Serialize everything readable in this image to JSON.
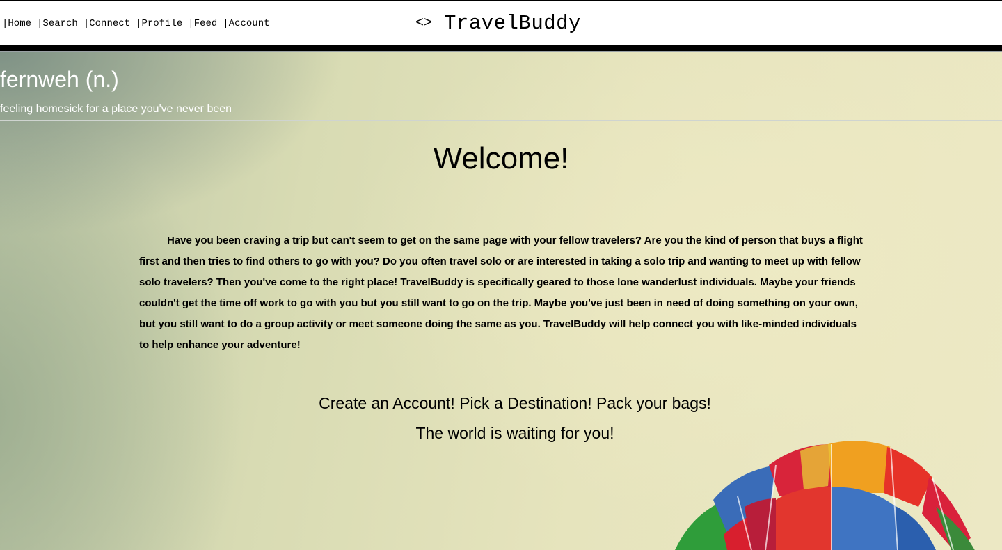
{
  "nav": {
    "items": [
      {
        "label": "Home"
      },
      {
        "label": "Search"
      },
      {
        "label": "Connect"
      },
      {
        "label": "Profile"
      },
      {
        "label": "Feed"
      },
      {
        "label": "Account"
      }
    ],
    "separator": "|"
  },
  "brand": {
    "icon": "<>",
    "name": "TravelBuddy"
  },
  "tagline": {
    "title": "fernweh (n.)",
    "subtitle": "feeling homesick for a place you've never been"
  },
  "main": {
    "heading": "Welcome!",
    "intro": "Have you been craving a trip but can't seem to get on the same page with your fellow travelers? Are you the kind of person that buys a flight first and then tries to find others to go with you? Do you often travel solo or are interested in taking a solo trip and wanting to meet up with fellow solo travelers? Then you've come to the right place! TravelBuddy is specifically geared to those lone wanderlust individuals. Maybe your friends couldn't get the time off work to go with you but you still want to go on the trip. Maybe you've just been in need of doing something on your own, but you still want to do a group activity or meet someone doing the same as you. TravelBuddy will help connect you with like-minded individuals to help enhance your adventure!",
    "cta_line1": "Create an Account! Pick a Destination! Pack your bags!",
    "cta_line2": "The world is waiting for you!"
  },
  "colors": {
    "nav_bg": "#ffffff",
    "rule": "#000000",
    "sky_light": "#ece8c4",
    "sky_dark": "#7f948a"
  }
}
